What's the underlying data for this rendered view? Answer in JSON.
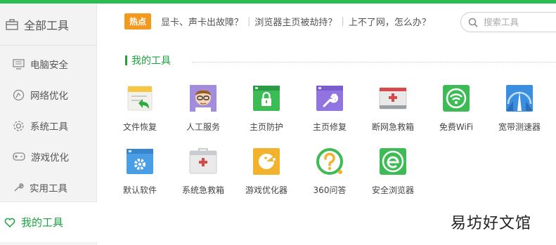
{
  "sidebar": {
    "all_tools": "全部工具",
    "items": [
      {
        "label": "电脑安全",
        "icon": "monitor-icon"
      },
      {
        "label": "网络优化",
        "icon": "network-icon"
      },
      {
        "label": "系统工具",
        "icon": "gear-icon"
      },
      {
        "label": "游戏优化",
        "icon": "gamepad-icon"
      },
      {
        "label": "实用工具",
        "icon": "wrench-icon"
      }
    ],
    "my_tools": "我的工具"
  },
  "hotbar": {
    "badge": "热点",
    "links": [
      "显卡、声卡出故障？",
      "浏览器主页被劫持？",
      "上不了网，怎么办？"
    ],
    "separator": "|"
  },
  "search": {
    "placeholder": "搜索工具"
  },
  "section": {
    "title": "我的工具"
  },
  "tools": [
    {
      "label": "文件恢复",
      "icon": "file-restore-icon"
    },
    {
      "label": "人工服务",
      "icon": "support-person-icon"
    },
    {
      "label": "主页防护",
      "icon": "homepage-lock-icon"
    },
    {
      "label": "主页修复",
      "icon": "homepage-repair-icon"
    },
    {
      "label": "断网急救箱",
      "icon": "network-firstaid-icon"
    },
    {
      "label": "免费WiFi",
      "icon": "wifi-icon"
    },
    {
      "label": "宽带测速器",
      "icon": "speedtest-icon"
    },
    {
      "label": "默认软件",
      "icon": "default-software-icon"
    },
    {
      "label": "系统急救箱",
      "icon": "system-firstaid-icon"
    },
    {
      "label": "游戏优化器",
      "icon": "game-optimizer-icon"
    },
    {
      "label": "360问答",
      "icon": "question-icon"
    },
    {
      "label": "安全浏览器",
      "icon": "safe-browser-icon"
    }
  ],
  "watermark": "易坊好文馆",
  "colors": {
    "accent": "#1aa33f",
    "topbar": "#2bbd4f",
    "hot": "#f39a1e"
  }
}
